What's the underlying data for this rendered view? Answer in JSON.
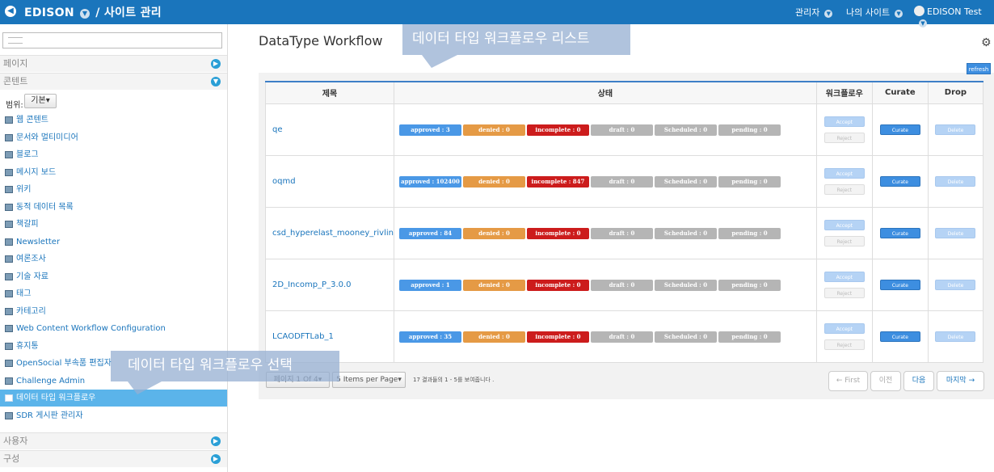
{
  "topbar": {
    "back_icon": "back-arrow-icon",
    "site_name": "EDISON",
    "section": "/ 사이트 관리",
    "admin_menu": "관리자",
    "mysites_menu": "나의 사이트",
    "user_name": "EDISON Test"
  },
  "sidebar": {
    "search_placeholder": "",
    "sections": {
      "pages": "페이지",
      "content": "콘텐트",
      "users": "사용자",
      "config": "구성"
    },
    "scope_label": "범위:",
    "scope_value": "기본",
    "items": [
      {
        "label": "웹 콘텐트",
        "icon": "web-content-icon"
      },
      {
        "label": "문서와 멀티미디어",
        "icon": "documents-icon"
      },
      {
        "label": "블로그",
        "icon": "blog-icon"
      },
      {
        "label": "메시지 보드",
        "icon": "message-board-icon"
      },
      {
        "label": "위키",
        "icon": "wiki-icon"
      },
      {
        "label": "동적 데이터 목록",
        "icon": "dynamic-data-icon"
      },
      {
        "label": "책갈피",
        "icon": "bookmark-icon"
      },
      {
        "label": "Newsletter",
        "icon": "newsletter-icon"
      },
      {
        "label": "여론조사",
        "icon": "poll-icon"
      },
      {
        "label": "기술 자료",
        "icon": "knowledge-base-icon"
      },
      {
        "label": "태그",
        "icon": "tag-icon"
      },
      {
        "label": "카테고리",
        "icon": "category-icon"
      },
      {
        "label": "Web Content Workflow Configuration",
        "icon": "workflow-config-icon"
      },
      {
        "label": "휴지통",
        "icon": "trash-icon"
      },
      {
        "label": "OpenSocial 부속품 편집자",
        "icon": "opensocial-icon"
      },
      {
        "label": "Challenge Admin",
        "icon": "challenge-icon"
      },
      {
        "label": "데이터 타입 워크플로우",
        "icon": "datatype-workflow-icon"
      },
      {
        "label": "SDR 게시판 관리자",
        "icon": "sdr-board-icon"
      }
    ]
  },
  "main": {
    "title": "DataType Workflow",
    "refresh_label": "refresh",
    "columns": [
      "제목",
      "상태",
      "워크플로우",
      "Curate",
      "Drop"
    ],
    "accept_label": "Accept",
    "reject_label": "Reject",
    "curate_label": "Curate",
    "delete_label": "Delete",
    "rows": [
      {
        "name": "qe",
        "approved": "approved : 3",
        "denied": "denied : 0",
        "incomplete": "incomplete : 0",
        "draft": "draft : 0",
        "scheduled": "Scheduled : 0",
        "pending": "pending : 0"
      },
      {
        "name": "oqmd",
        "approved": "approved : 102400",
        "denied": "denied : 0",
        "incomplete": "incomplete : 847",
        "draft": "draft : 0",
        "scheduled": "Scheduled : 0",
        "pending": "pending : 0"
      },
      {
        "name": "csd_hyperelast_mooney_rivlin",
        "approved": "approved : 84",
        "denied": "denied : 0",
        "incomplete": "incomplete : 0",
        "draft": "draft : 0",
        "scheduled": "Scheduled : 0",
        "pending": "pending : 0"
      },
      {
        "name": "2D_Incomp_P_3.0.0",
        "approved": "approved : 1",
        "denied": "denied : 0",
        "incomplete": "incomplete : 0",
        "draft": "draft : 0",
        "scheduled": "Scheduled : 0",
        "pending": "pending : 0"
      },
      {
        "name": "LCAODFTLab_1",
        "approved": "approved : 35",
        "denied": "denied : 0",
        "incomplete": "incomplete : 0",
        "draft": "draft : 0",
        "scheduled": "Scheduled : 0",
        "pending": "pending : 0"
      }
    ],
    "pager": {
      "page": "페이지 1 Of 4",
      "per_page": "5 Items per Page",
      "info": "17 결과들의 1 - 5를 보여줍니다 .",
      "first": "← First",
      "prev": "이전",
      "next": "다음",
      "last": "마지막 →"
    }
  },
  "callouts": {
    "list": "데이터 타입 워크플로우 리스트",
    "select": "데이터 타입 워크플로우 선택"
  },
  "colors": {
    "approved": "#4a98e6",
    "denied": "#e59a45",
    "incomplete": "#cc1c1c",
    "neutral": "#b5b5b5",
    "topbar": "#1a75bc"
  }
}
